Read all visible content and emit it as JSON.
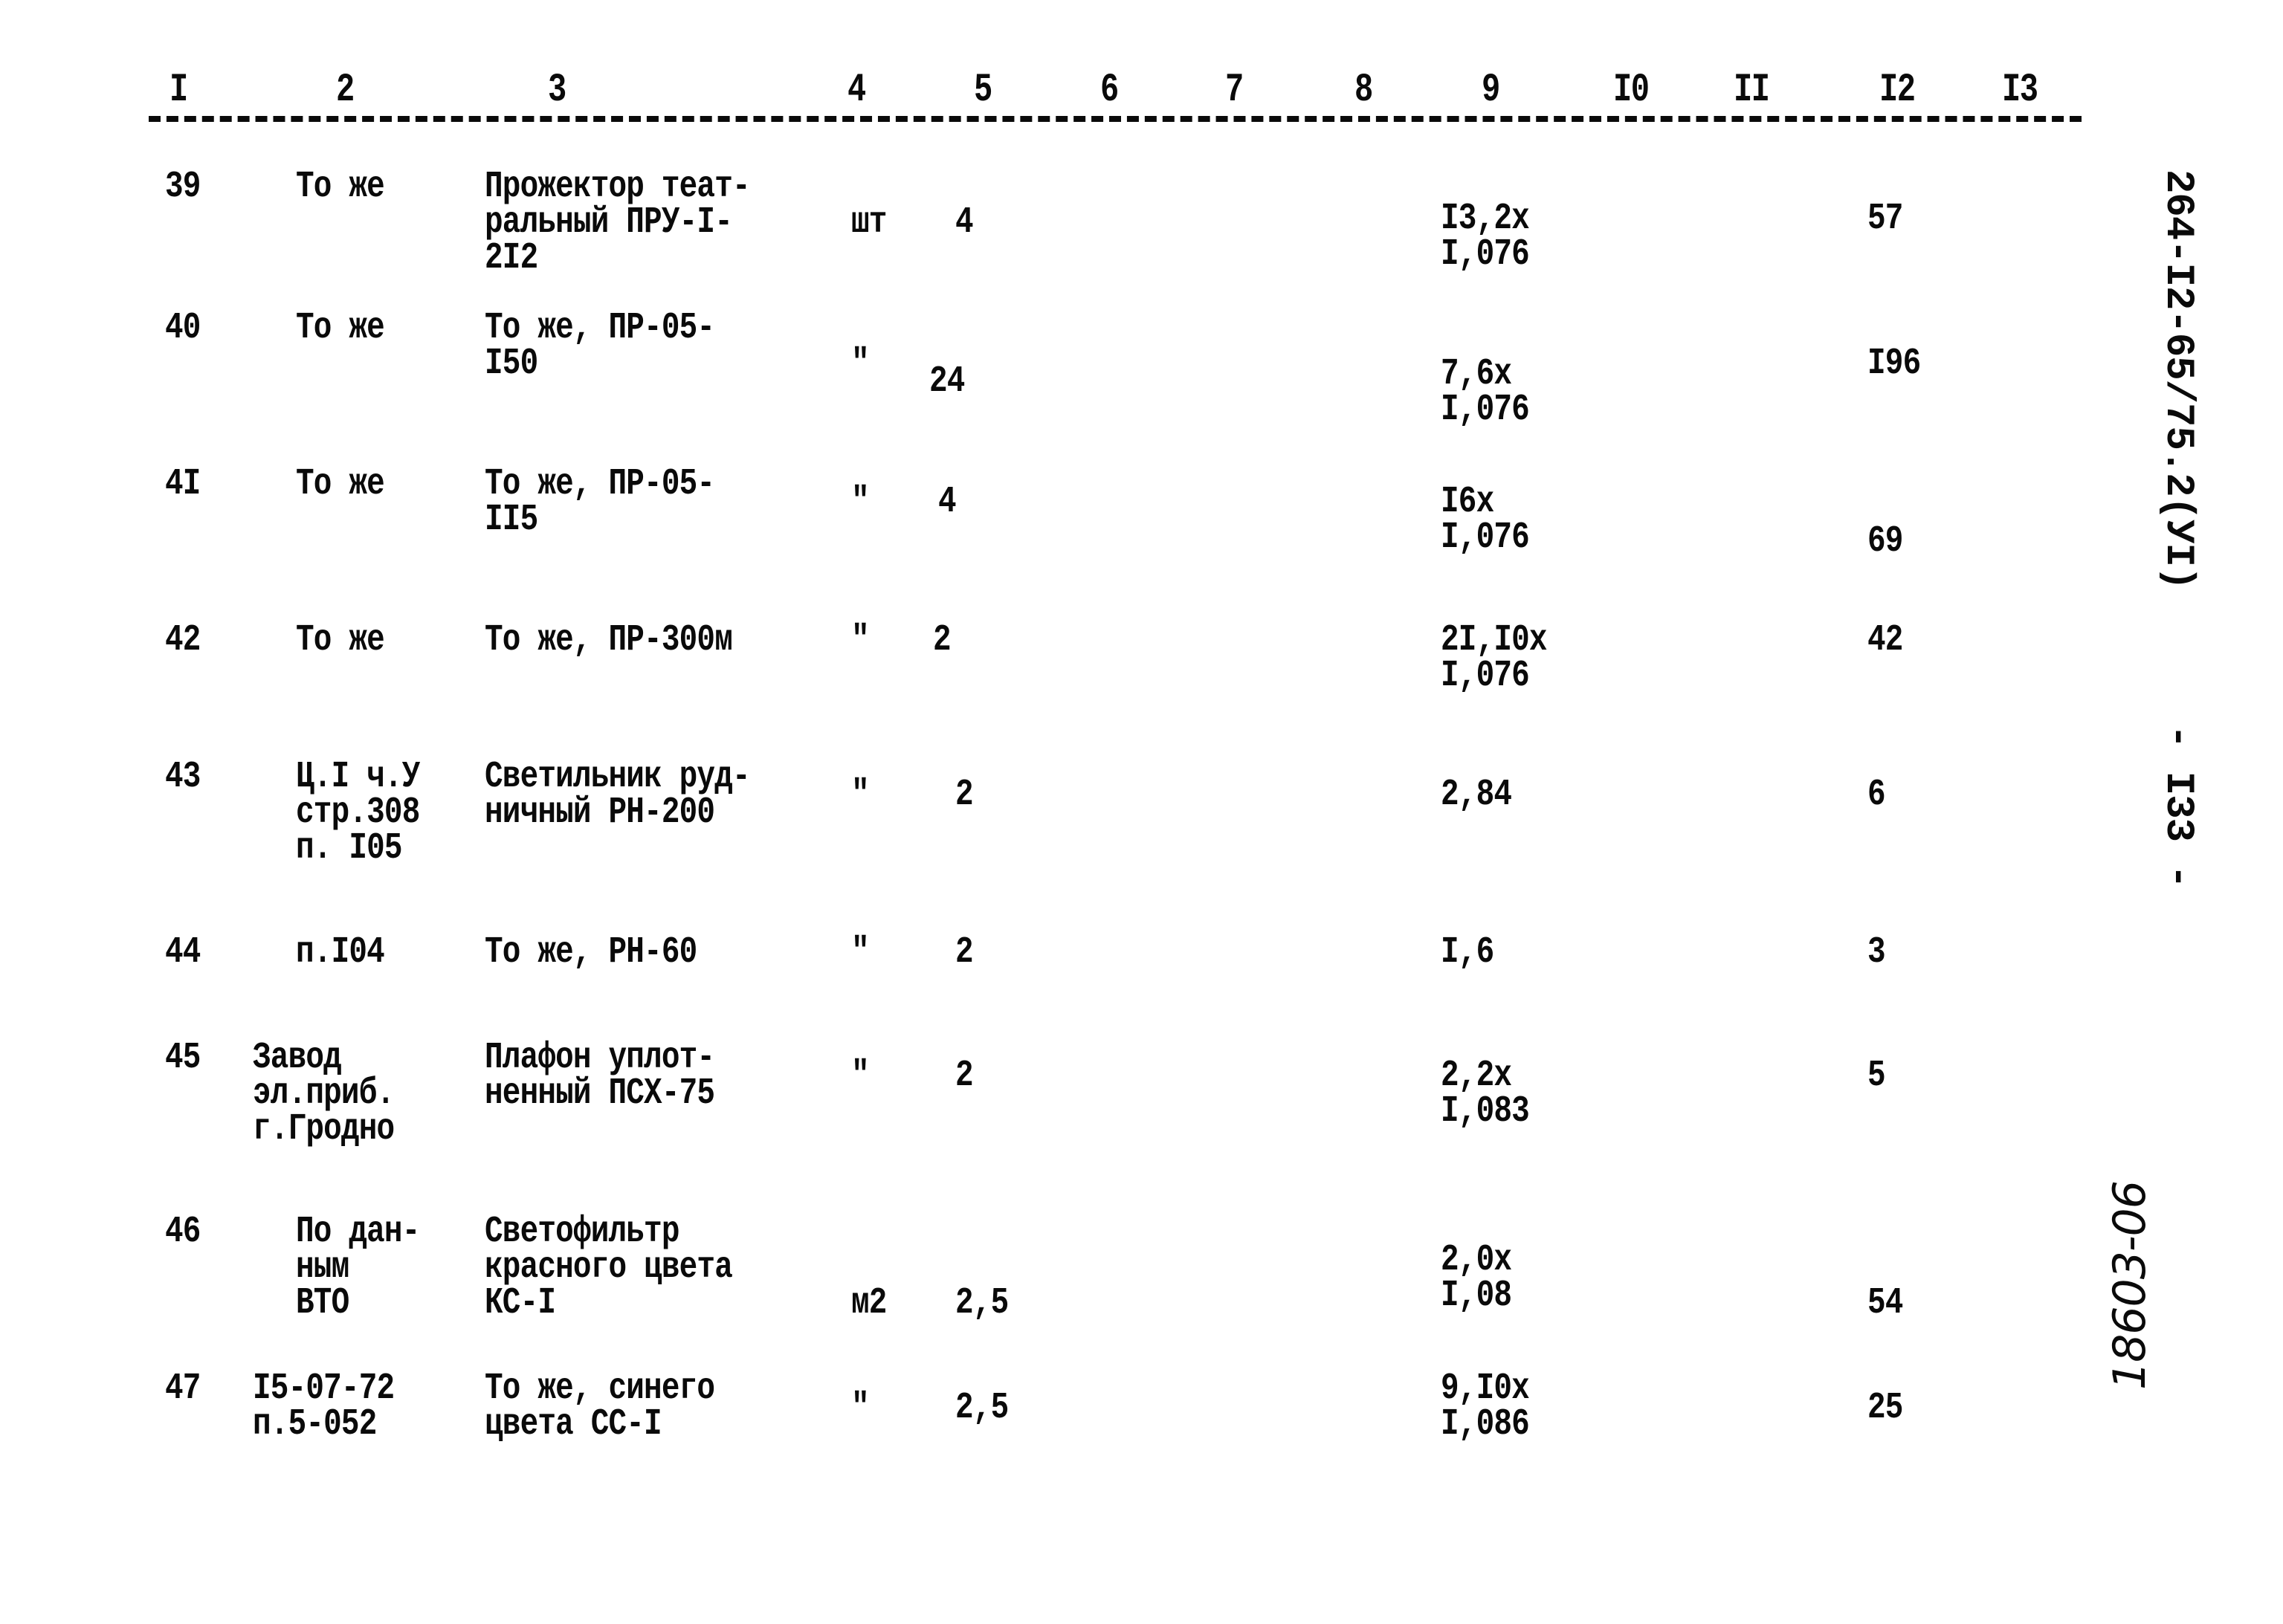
{
  "document": {
    "column_headers": [
      "I",
      "2",
      "3",
      "4",
      "5",
      "6",
      "7",
      "8",
      "9",
      "I0",
      "II",
      "I2",
      "I3"
    ],
    "rows": [
      {
        "no": "39",
        "source": [
          "То же"
        ],
        "name": [
          "Прожектор теат-",
          "ральный ПРУ-I-",
          "2I2"
        ],
        "unit": "шт",
        "qty": "4",
        "col9": [
          "I3,2x",
          "I,076"
        ],
        "col12": "57"
      },
      {
        "no": "40",
        "source": [
          "То же"
        ],
        "name": [
          "То же, ПР-05-",
          "I50"
        ],
        "unit": "\"",
        "qty": "24",
        "col9": [
          "7,6x",
          "I,076"
        ],
        "col12": "I96"
      },
      {
        "no": "4I",
        "source": [
          "То же"
        ],
        "name": [
          "То же, ПР-05-",
          "II5"
        ],
        "unit": "\"",
        "qty": "4",
        "col9": [
          "I6x",
          "I,076"
        ],
        "col12": "69"
      },
      {
        "no": "42",
        "source": [
          "То же"
        ],
        "name": [
          "То же, ПР-300м"
        ],
        "unit": "\"",
        "qty": "2",
        "col9": [
          "2I,I0x",
          "I,076"
        ],
        "col12": "42"
      },
      {
        "no": "43",
        "source": [
          "Ц.I ч.У",
          "стр.308",
          "п. I05"
        ],
        "name": [
          "Светильник руд-",
          "ничный РН-200"
        ],
        "unit": "\"",
        "qty": "2",
        "col9": [
          "2,84"
        ],
        "col12": "6"
      },
      {
        "no": "44",
        "source": [
          "п.I04"
        ],
        "name": [
          "То же, РН-60"
        ],
        "unit": "\"",
        "qty": "2",
        "col9": [
          "I,6"
        ],
        "col12": "3"
      },
      {
        "no": "45",
        "source": [
          "Завод",
          "эл.приб.",
          "г.Гродно"
        ],
        "name": [
          "Плафон уплот-",
          "ненный ПСХ-75"
        ],
        "unit": "\"",
        "qty": "2",
        "col9": [
          "2,2x",
          "I,083"
        ],
        "col12": "5"
      },
      {
        "no": "46",
        "source": [
          "По дан-",
          "ным",
          "ВТО"
        ],
        "name": [
          "Светофильтр",
          "красного цвета",
          "КС-I"
        ],
        "unit": "м2",
        "qty": "2,5",
        "col9": [
          "2,0x",
          "I,08"
        ],
        "col12": "54"
      },
      {
        "no": "47",
        "source": [
          "I5-07-72",
          "п.5-052"
        ],
        "name": [
          "То же, синего",
          "цвета СС-I"
        ],
        "unit": "\"",
        "qty": "2,5",
        "col9": [
          "9,I0x",
          "I,086"
        ],
        "col12": "25"
      }
    ]
  },
  "margin": {
    "doc_code": "264-I2-65/75.2(УI)",
    "page_number": "- I33 -",
    "archive_number": "18603-06"
  }
}
